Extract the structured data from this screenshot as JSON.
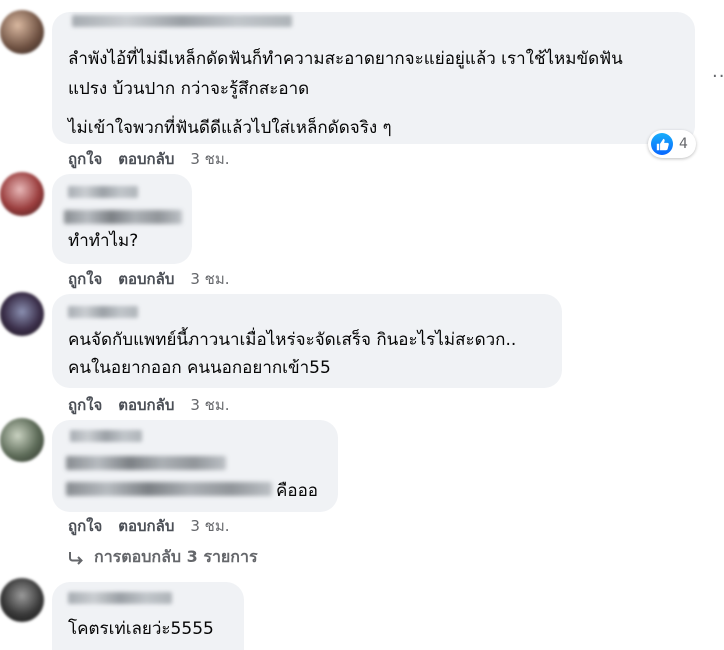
{
  "comments": [
    {
      "lines": [
        "ลำพังไอ้ที่ไม่มีเหล็กดัดฟันก็ทำความสะอาดยากจะแย่อยู่แล้ว เราใช้ไหมขัดฟัน",
        "แปรง บ้วนปาก กว่าจะรู้สึกสะอาด",
        "ไม่เข้าใจพวกที่ฟันดีดีแล้วไปใส่เหล็กดัดจริง ๆ"
      ],
      "like_label": "ถูกใจ",
      "reply_label": "ตอบกลับ",
      "time": "3 ชม.",
      "reaction_count": "4"
    },
    {
      "lines": [
        "ทำทำไม?"
      ],
      "like_label": "ถูกใจ",
      "reply_label": "ตอบกลับ",
      "time": "3 ชม."
    },
    {
      "lines": [
        "คนจัดกับแพทย์นี้ภาวนาเมื่อไหร่จะจัดเสร็จ กินอะไรไม่สะดวก..",
        "คนในอยากออก คนนอกอยากเข้า55"
      ],
      "like_label": "ถูกใจ",
      "reply_label": "ตอบกลับ",
      "time": "3 ชม."
    },
    {
      "lines": [
        "คือออ"
      ],
      "like_label": "ถูกใจ",
      "reply_label": "ตอบกลับ",
      "time": "3 ชม.",
      "replies_label": "การตอบกลับ 3 รายการ"
    },
    {
      "lines": [
        "โคตรเท่เลยว่ะ5555"
      ]
    }
  ],
  "icons": {
    "like": "like-icon",
    "more": "more-options-icon",
    "reply_arrow": "reply-arrow-icon"
  },
  "colors": {
    "bubble": "#f0f2f5",
    "meta": "#65676b",
    "like_blue": "#0866ff"
  }
}
